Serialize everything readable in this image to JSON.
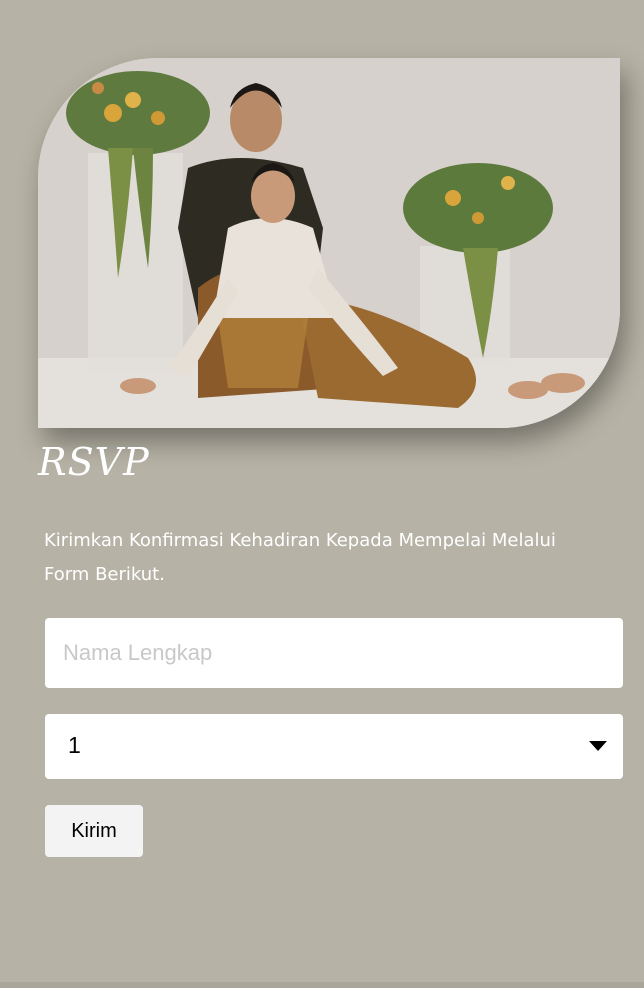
{
  "rsvp": {
    "heading": "RSVP",
    "intro": "Kirimkan Konfirmasi Kehadiran Kepada Mempelai Melalui Form Berikut.",
    "name_placeholder": "Nama Lengkap",
    "guest_count_value": "1",
    "submit_label": "Kirim"
  },
  "colors": {
    "background": "#b6b2a5",
    "text": "#ffffff",
    "field_background": "#ffffff",
    "button_background": "#f3f3f3"
  },
  "icons": {
    "select_arrow": "dropdown-triangle-icon"
  }
}
